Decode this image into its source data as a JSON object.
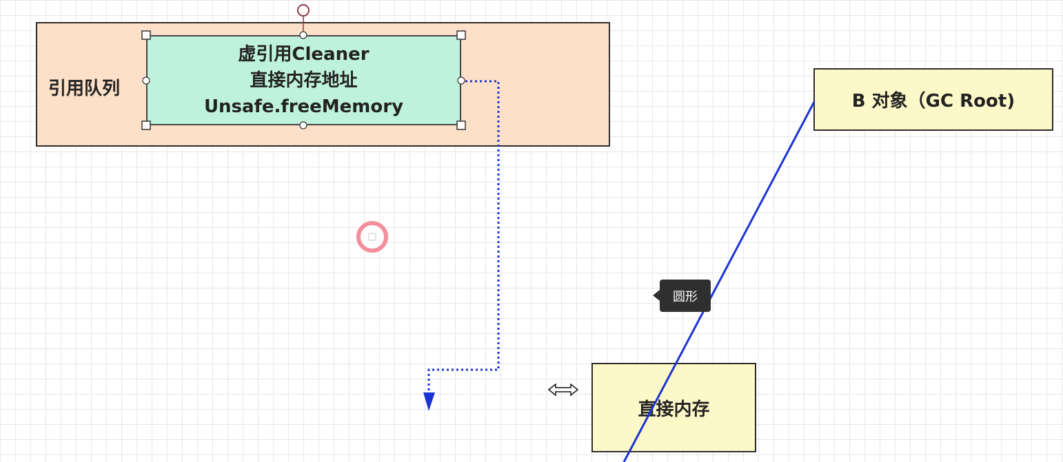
{
  "nodes": {
    "reference_queue": {
      "label": "引用队列"
    },
    "cleaner": {
      "lines": [
        "虚引用Cleaner",
        "直接内存地址",
        "Unsafe.freeMemory"
      ]
    },
    "gc_root": {
      "label": "B 对象（GC Root)"
    },
    "direct_memory": {
      "label": "直接内存"
    }
  },
  "tooltip": {
    "label": "圆形"
  },
  "colors": {
    "queue_fill": "#fde0c8",
    "cleaner_fill": "#bff2dc",
    "node_fill": "#fdf8c8",
    "edge_color": "#1a33d6",
    "cursor_ring": "#f06a7e"
  },
  "icons": {
    "cursor": "circle-cursor-icon",
    "resize": "horizontal-resize-cursor-icon"
  }
}
